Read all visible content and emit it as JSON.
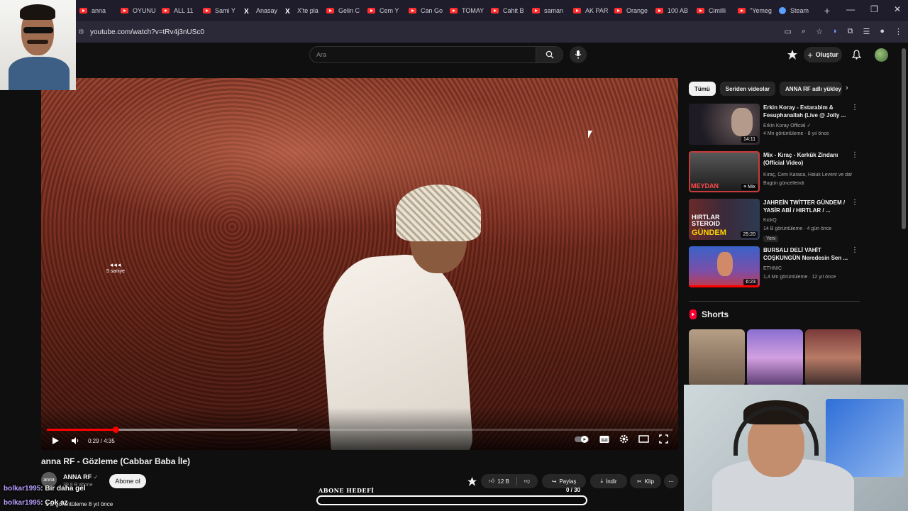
{
  "browser": {
    "tabs": [
      {
        "label": "anna",
        "icon": "youtube-icon"
      },
      {
        "label": "OYUNU",
        "icon": "youtube-icon"
      },
      {
        "label": "ALL 11",
        "icon": "youtube-icon"
      },
      {
        "label": "Sami Y",
        "icon": "youtube-icon"
      },
      {
        "label": "Anasay",
        "icon": "x-icon"
      },
      {
        "label": "X'te pla",
        "icon": "x-icon"
      },
      {
        "label": "Gelin C",
        "icon": "youtube-icon"
      },
      {
        "label": "Cem Y",
        "icon": "youtube-icon"
      },
      {
        "label": "Can Go",
        "icon": "youtube-icon"
      },
      {
        "label": "TOMAY",
        "icon": "youtube-icon"
      },
      {
        "label": "Cahit B",
        "icon": "youtube-icon"
      },
      {
        "label": "saman",
        "icon": "youtube-icon"
      },
      {
        "label": "AK PAR",
        "icon": "youtube-icon"
      },
      {
        "label": "Orange",
        "icon": "youtube-icon"
      },
      {
        "label": "100 AB",
        "icon": "youtube-icon"
      },
      {
        "label": "Cimilli",
        "icon": "youtube-icon"
      },
      {
        "label": "\"Yemeg",
        "icon": "youtube-icon"
      },
      {
        "label": "Steam",
        "icon": "steam-icon"
      }
    ],
    "url": "youtube.com/watch?v=tRv4j3nUSc0"
  },
  "header": {
    "search_placeholder": "Ara",
    "create_label": "Oluştur"
  },
  "player": {
    "current_time": "0:29 / 4:35",
    "played_fraction": 0.11,
    "buffered_fraction": 0.4,
    "seek_hint": "5 saniye"
  },
  "video": {
    "title": "anna RF - Gözleme (Cabbar Baba İle)",
    "channel": "ANNA RF",
    "channel_avatar_text": "anna",
    "subscribers": "39,8 B abone",
    "subscribe_label": "Abone ol",
    "likes": "12 B",
    "share_label": "Paylaş",
    "download_label": "İndir",
    "clip_label": "Klip",
    "views": "9 B görüntüleme  8 yıl önce"
  },
  "chat": [
    {
      "user": "bolkar1995",
      "message": ": Bir daha gel"
    },
    {
      "user": "bolkar1995",
      "message": ": Çok az"
    }
  ],
  "goal": {
    "label": "ABONE HEDEFİ",
    "count": "0 / 30",
    "progress": 0
  },
  "sidebar": {
    "chips": [
      "Tümü",
      "Seriden videolar",
      "ANNA RF adlı yükley"
    ],
    "recommendations": [
      {
        "title": "Erkin Koray - Estarabim & Fesuphanallah (Live @ Jolly ...",
        "channel": "Erkin Koray Official",
        "meta": "4 Mn görüntüleme · 8 yıl önce",
        "duration": "14:11",
        "badge": ""
      },
      {
        "title": "Mix - Kıraç - Kerkük Zindanı (Official Video)",
        "channel": "Kıraç, Cem Karaca, Haluk Levent ve daha...",
        "meta": "Bugün güncellendi",
        "duration": "Mix",
        "badge": ""
      },
      {
        "title": "JAHREİN TWİTTER GÜNDEM / YASİR ABİ / HIRTLAR / ...",
        "channel": "KickQ",
        "meta": "14 B görüntüleme · 4 gün önce",
        "duration": "25:20",
        "badge": "Yeni"
      },
      {
        "title": "BURSALI DELİ VAHİT COŞKUNGÜN Neredesin Sen ...",
        "channel": "ETHNİC",
        "meta": "1,4 Mn görüntüleme · 12 yıl önce",
        "duration": "6:23",
        "badge": ""
      }
    ],
    "shorts_title": "Shorts"
  },
  "thumb_text": {
    "rec2": "MEYDAN",
    "rec3_line1": "HIRTLAR",
    "rec3_line2": "STEROID",
    "rec3_line3": "GÜNDEM"
  }
}
